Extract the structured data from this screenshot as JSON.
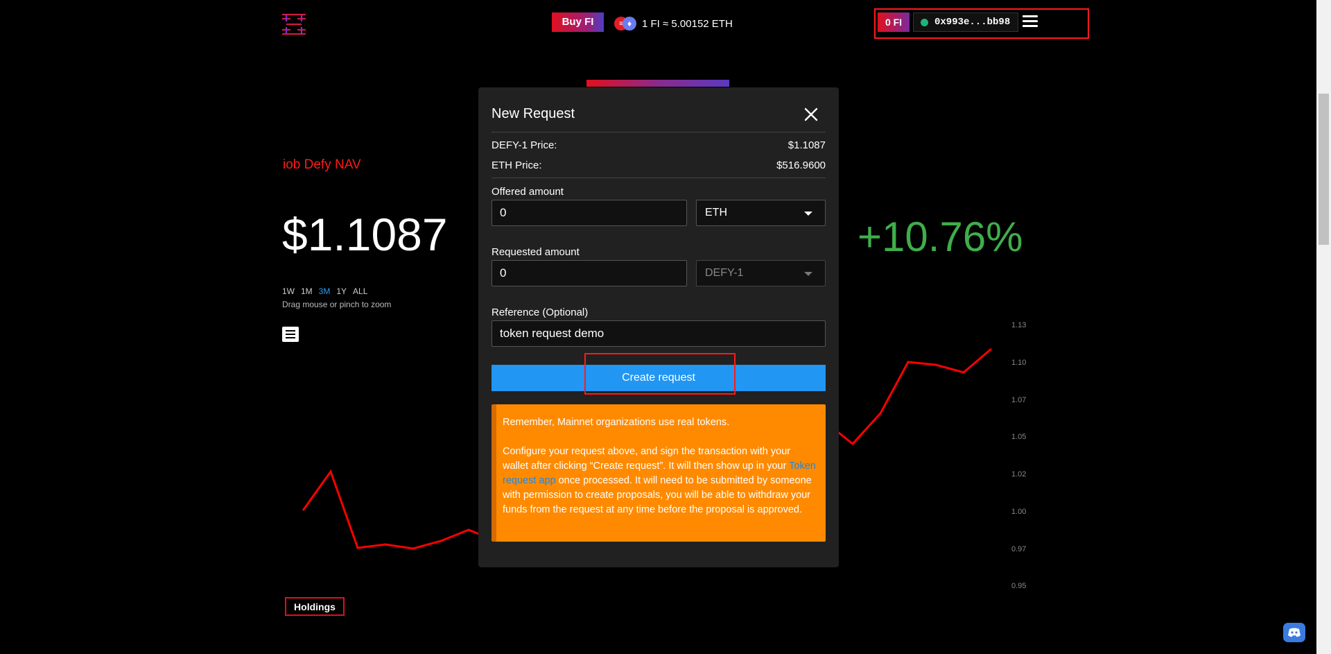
{
  "header": {
    "buy_label": "Buy FI",
    "rate_text": "1 FI ≈ 5.00152 ETH",
    "fi_balance": "0 FI",
    "wallet_address": "0x993e...bb98"
  },
  "page": {
    "nav_title": "iob Defy NAV",
    "nav_price": "$1.1087",
    "change_pct": "+10.76%",
    "ranges": [
      "1W",
      "1M",
      "3M",
      "1Y",
      "ALL"
    ],
    "active_range": "3M",
    "zoom_hint": "Drag mouse or pinch to zoom",
    "holdings_label": "Holdings",
    "chart_y_ticks": [
      "1.13",
      "1.10",
      "1.07",
      "1.05",
      "1.02",
      "1.00",
      "0.97",
      "0.95"
    ],
    "chart_color": "#ff0000"
  },
  "modal": {
    "title": "New Request",
    "defy_price_label": "DEFY-1 Price:",
    "defy_price_value": "$1.1087",
    "eth_price_label": "ETH Price:",
    "eth_price_value": "$516.9600",
    "offered_label": "Offered amount",
    "offered_value": "0",
    "offered_token": "ETH",
    "requested_label": "Requested amount",
    "requested_value": "0",
    "requested_token": "DEFY-1",
    "reference_label": "Reference (Optional)",
    "reference_value": "token request demo",
    "create_label": "Create request",
    "notice_p1": "Remember, Mainnet organizations use real tokens.",
    "notice_p2_a": "Configure your request above, and sign the transaction with your wallet after clicking “Create request”. It will then show up in your ",
    "notice_link": "Token request app",
    "notice_p2_b": " once processed. It will need to be submitted by someone with permission to create proposals, you will be able to withdraw your funds from the request at any time before the proposal is approved."
  }
}
